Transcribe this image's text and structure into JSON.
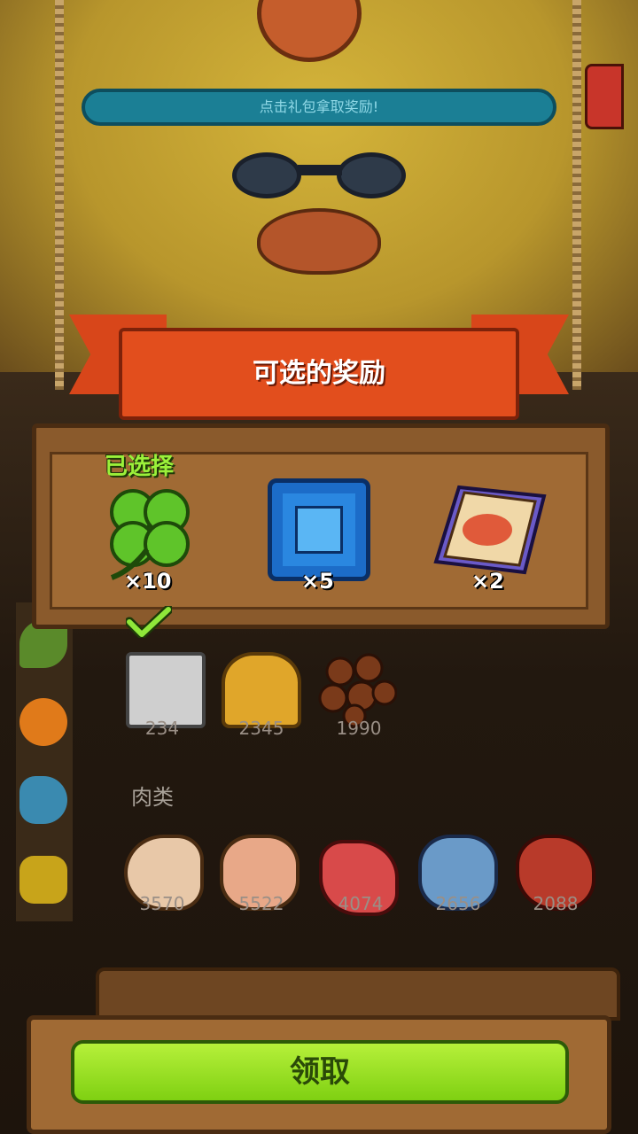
{
  "tip_bar": {
    "text": "点击礼包拿取奖励!"
  },
  "banner": {
    "title": "可选的奖励"
  },
  "rewards": {
    "selected_label": "已选择",
    "items": [
      {
        "icon": "four-leaf-clover-icon",
        "qty": "×10",
        "selected": true
      },
      {
        "icon": "blue-gem-icon",
        "qty": "×5",
        "selected": false
      },
      {
        "icon": "recipe-scroll-icon",
        "qty": "×2",
        "selected": false
      }
    ]
  },
  "inventory": {
    "dairy": [
      {
        "icon": "milk-carton-icon",
        "count": "234"
      },
      {
        "icon": "honeycomb-icon",
        "count": "2345"
      },
      {
        "icon": "meatballs-icon",
        "count": "1990"
      }
    ],
    "meat_heading": "肉类",
    "meat": [
      {
        "icon": "drumstick-icon",
        "count": "3570"
      },
      {
        "icon": "ham-roll-icon",
        "count": "5522"
      },
      {
        "icon": "steak-icon",
        "count": "4074"
      },
      {
        "icon": "blue-meat-icon",
        "count": "2656"
      },
      {
        "icon": "red-meat-icon",
        "count": "2088"
      }
    ]
  },
  "footer": {
    "claim_label": "领取"
  },
  "colors": {
    "accent_green": "#9bf03a",
    "banner_red": "#e24e1d",
    "wood": "#a06a34"
  }
}
